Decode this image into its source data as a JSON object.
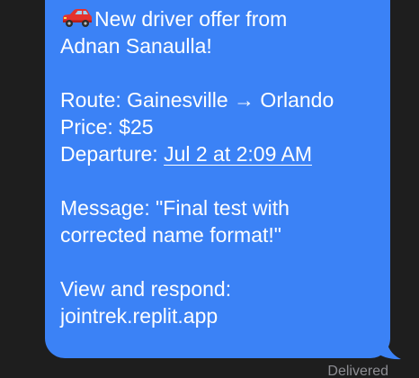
{
  "message": {
    "icon": "car-icon",
    "headline_1": "New driver offer from",
    "headline_2": "Adnan Sanaulla!",
    "route_label": "Route:",
    "route_value": "Gainesville → Orlando",
    "price_label": "Price:",
    "price_value": "$25",
    "departure_label": "Departure:",
    "departure_value": "Jul 2 at 2:09 AM",
    "message_line_1": "Message: \"Final test with",
    "message_line_2": "corrected name format!\"",
    "respond_line": "View and respond:",
    "link": "jointrek.replit.app"
  },
  "status": {
    "delivered": "Delivered"
  },
  "colors": {
    "bubble": "#3b82f6",
    "background": "#1e1e1e",
    "status_text": "#8e8e93",
    "text": "#ffffff"
  }
}
